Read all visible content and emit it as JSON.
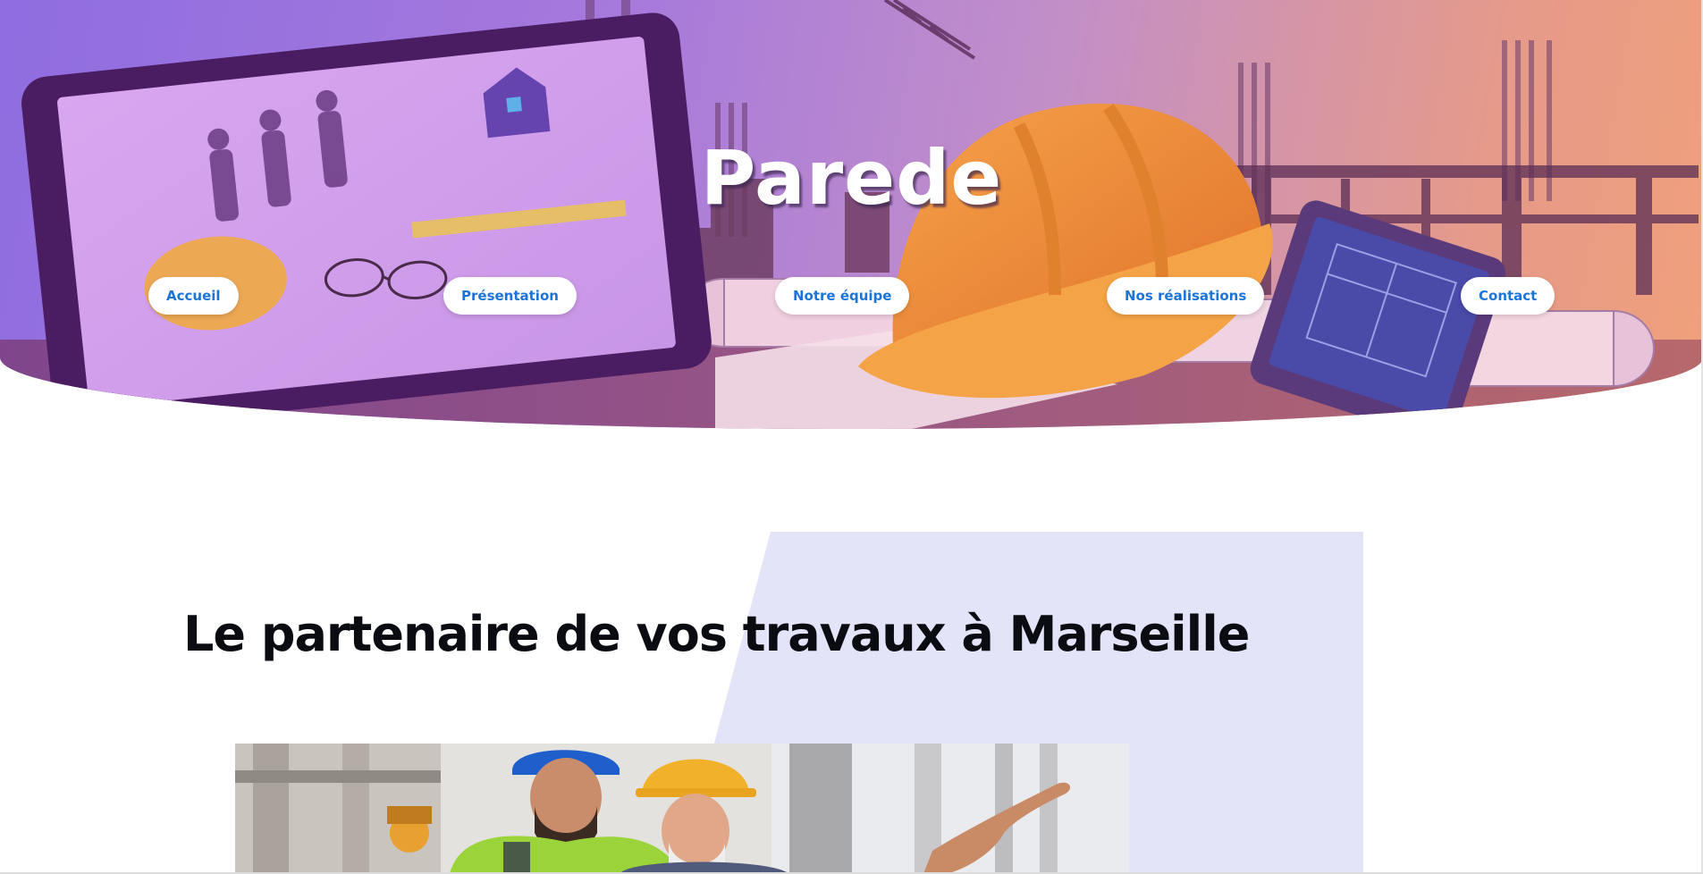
{
  "site": {
    "title": "Parede"
  },
  "nav": {
    "items": [
      {
        "label": "Accueil"
      },
      {
        "label": "Présentation"
      },
      {
        "label": "Notre équipe"
      },
      {
        "label": "Nos réalisations"
      },
      {
        "label": "Contact"
      }
    ]
  },
  "intro": {
    "heading": "Le partenaire de vos travaux à Marseille"
  },
  "colors": {
    "nav_text": "#1d74d8",
    "accent_panel": "#e4e4f8",
    "heading": "#0b0b12",
    "hero_gradient_start": "#8f6de0",
    "hero_gradient_end": "#f0a07a"
  },
  "images": {
    "hero": "construction-site-hero-image",
    "intro_photo": "construction-workers-photo"
  }
}
